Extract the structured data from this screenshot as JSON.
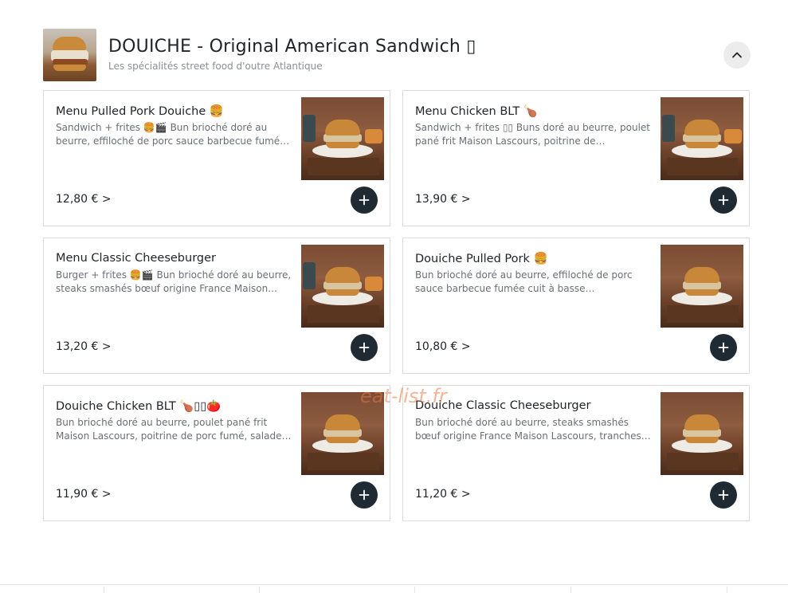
{
  "section": {
    "title": "DOUICHE - Original American Sandwich ▯",
    "subtitle": "Les spécialités street food d'outre Atlantique",
    "collapse_icon": "chevron-up-icon",
    "add_icon": "plus-icon"
  },
  "products": [
    {
      "name": "Menu Pulled Pork Douiche 🍔",
      "description": "Sandwich + frites 🍔🎬 Bun brioché doré au beurre, effiloché de porc sauce barbecue fumé…",
      "price": "12,80 € >"
    },
    {
      "name": "Menu Chicken BLT 🍗",
      "description": "Sandwich + frites ▯▯ Buns doré au beurre, poulet pané frit Maison Lascours, poitrine de…",
      "price": "13,90 € >"
    },
    {
      "name": "Menu Classic Cheeseburger",
      "description": "Burger + frites 🍔🎬 Bun brioché doré au beurre, steaks smashés bœuf origine France Maison…",
      "price": "13,20 € >"
    },
    {
      "name": "Douiche Pulled Pork 🍔",
      "description": "Bun brioché doré au beurre, effiloché de porc sauce barbecue fumée cuit à basse…",
      "price": "10,80 € >"
    },
    {
      "name": "Douiche Chicken BLT 🍗▯▯🍅",
      "description": "Bun brioché doré au beurre, poulet pané frit Maison Lascours, poitrine de porc fumé, salade…",
      "price": "11,90 € >"
    },
    {
      "name": "Douiche Classic Cheeseburger",
      "description": "Bun brioché doré au beurre, steaks smashés bœuf origine France Maison Lascours, tranches…",
      "price": "11,20 € >"
    }
  ],
  "watermark": "eat-list.fr"
}
